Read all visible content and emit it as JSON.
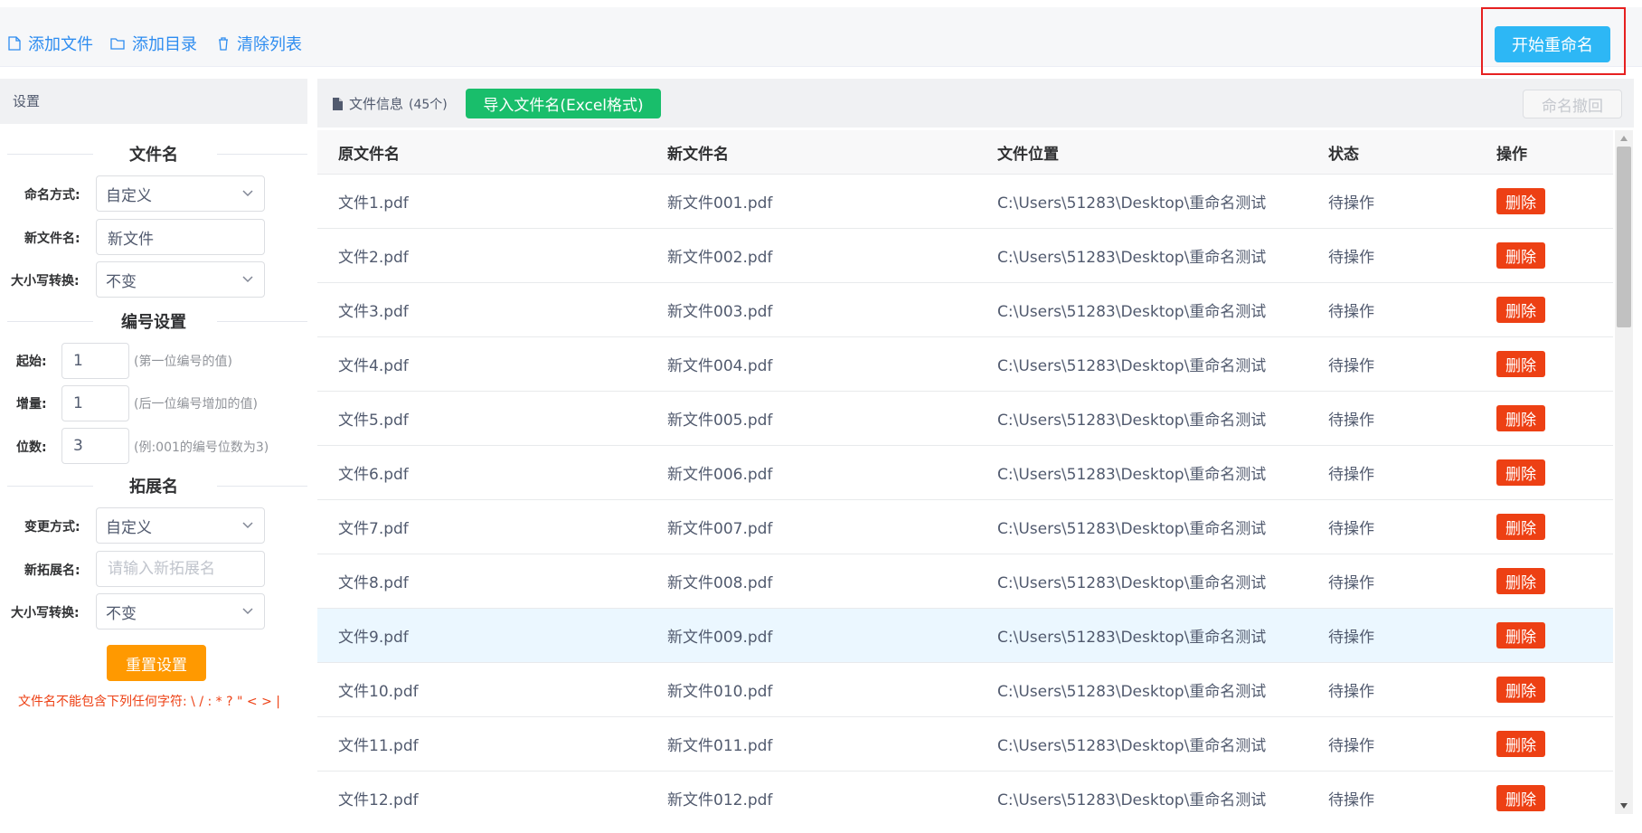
{
  "toolbar": {
    "add_file": "添加文件",
    "add_folder": "添加目录",
    "clear_list": "清除列表",
    "start_rename": "开始重命名"
  },
  "settings": {
    "header": "设置",
    "filename_section": "文件名",
    "naming_method_label": "命名方式:",
    "naming_method_value": "自定义",
    "new_filename_label": "新文件名:",
    "new_filename_value": "新文件",
    "case_label": "大小写转换:",
    "case_value": "不变",
    "numbering_section": "编号设置",
    "start_label": "起始:",
    "start_value": "1",
    "start_hint": "(第一位编号的值)",
    "increment_label": "增量:",
    "increment_value": "1",
    "increment_hint": "(后一位编号增加的值)",
    "digits_label": "位数:",
    "digits_value": "3",
    "digits_hint": "(例:001的编号位数为3)",
    "extension_section": "拓展名",
    "change_method_label": "变更方式:",
    "change_method_value": "自定义",
    "new_extension_label": "新拓展名:",
    "new_extension_placeholder": "请输入新拓展名",
    "ext_case_label": "大小写转换:",
    "ext_case_value": "不变",
    "reset_button": "重置设置",
    "warning": "文件名不能包含下列任何字符: \\ / : * ? \" < > |"
  },
  "files": {
    "title": "文件信息",
    "count": "(45个)",
    "import_button": "导入文件名(Excel格式)",
    "undo_button": "命名撤回",
    "columns": [
      "原文件名",
      "新文件名",
      "文件位置",
      "状态",
      "操作"
    ],
    "delete_label": "删除",
    "rows": [
      {
        "original": "文件1.pdf",
        "new": "新文件001.pdf",
        "location": "C:\\Users\\51283\\Desktop\\重命名测试",
        "status": "待操作"
      },
      {
        "original": "文件2.pdf",
        "new": "新文件002.pdf",
        "location": "C:\\Users\\51283\\Desktop\\重命名测试",
        "status": "待操作"
      },
      {
        "original": "文件3.pdf",
        "new": "新文件003.pdf",
        "location": "C:\\Users\\51283\\Desktop\\重命名测试",
        "status": "待操作"
      },
      {
        "original": "文件4.pdf",
        "new": "新文件004.pdf",
        "location": "C:\\Users\\51283\\Desktop\\重命名测试",
        "status": "待操作"
      },
      {
        "original": "文件5.pdf",
        "new": "新文件005.pdf",
        "location": "C:\\Users\\51283\\Desktop\\重命名测试",
        "status": "待操作"
      },
      {
        "original": "文件6.pdf",
        "new": "新文件006.pdf",
        "location": "C:\\Users\\51283\\Desktop\\重命名测试",
        "status": "待操作"
      },
      {
        "original": "文件7.pdf",
        "new": "新文件007.pdf",
        "location": "C:\\Users\\51283\\Desktop\\重命名测试",
        "status": "待操作"
      },
      {
        "original": "文件8.pdf",
        "new": "新文件008.pdf",
        "location": "C:\\Users\\51283\\Desktop\\重命名测试",
        "status": "待操作"
      },
      {
        "original": "文件9.pdf",
        "new": "新文件009.pdf",
        "location": "C:\\Users\\51283\\Desktop\\重命名测试",
        "status": "待操作"
      },
      {
        "original": "文件10.pdf",
        "new": "新文件010.pdf",
        "location": "C:\\Users\\51283\\Desktop\\重命名测试",
        "status": "待操作"
      },
      {
        "original": "文件11.pdf",
        "new": "新文件011.pdf",
        "location": "C:\\Users\\51283\\Desktop\\重命名测试",
        "status": "待操作"
      },
      {
        "original": "文件12.pdf",
        "new": "新文件012.pdf",
        "location": "C:\\Users\\51283\\Desktop\\重命名测试",
        "status": "待操作"
      }
    ]
  },
  "colors": {
    "primary": "#2db7f5",
    "link": "#2d8cf0",
    "success": "#19be6b",
    "warning": "#ff9900",
    "danger": "#ed4014",
    "highlight_frame": "#e62020"
  }
}
